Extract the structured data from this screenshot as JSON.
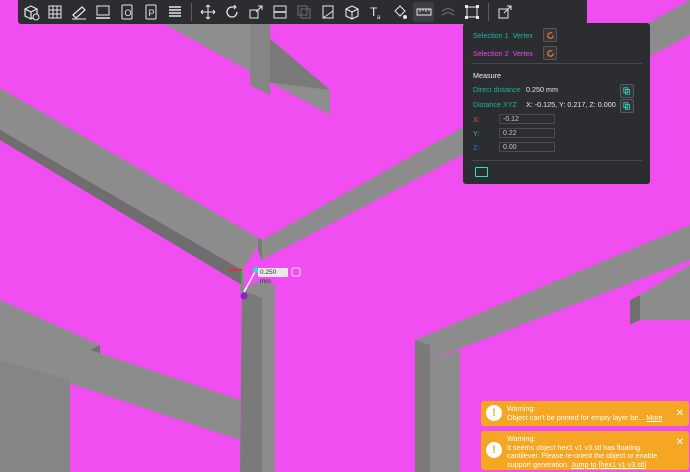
{
  "toolbar": {
    "items": [
      "add-object-icon",
      "arrange-grid-icon",
      "orient-icon",
      "lay-on-face-icon",
      "split-objects-icon",
      "split-parts-icon",
      "layers-icon",
      "move-icon",
      "rotate-icon",
      "scale-icon",
      "cut-icon",
      "mesh-boolean-icon",
      "place-on-face-icon",
      "support-paint-icon",
      "seam-paint-icon",
      "text-icon",
      "color-paint-icon",
      "measure-icon",
      "assembly-icon",
      "cut-tool-icon",
      "project-icon"
    ]
  },
  "measure_panel": {
    "selection1_label": "Selection 1",
    "selection1_value": "Vertex",
    "selection2_label": "Selection 2",
    "selection2_value": "Vertex",
    "section_title": "Measure",
    "direct_distance_label": "Direct distance",
    "direct_distance_value": "0.250 mm",
    "distance_xyz_label": "Distance XYZ",
    "distance_xyz_value": "X: -0.125, Y: 0.217, Z: 0.000",
    "x_label": "X:",
    "x_value": "-0.12",
    "y_label": "Y:",
    "y_value": "0.22",
    "z_label": "Z:",
    "z_value": "0.00",
    "colors": {
      "teal": "#1fb4a0",
      "selection2": "#e44be4",
      "panel_bg": "#2b2d31"
    }
  },
  "viewport": {
    "dimension_label": "0.250 mm",
    "background_color": "#f04ef0",
    "model_color": "#8f8f8f"
  },
  "notifications": [
    {
      "title": "Warning:",
      "message": "Object can't be printed for empty layer be...",
      "link": "More"
    },
    {
      "title": "Warning:",
      "message": "It seems object hex1 v1 v3.stl has floating cantilever. Please re-orient the object or enable support generation.",
      "link": "Jump to [hex1 v1 v3.stl]"
    }
  ]
}
